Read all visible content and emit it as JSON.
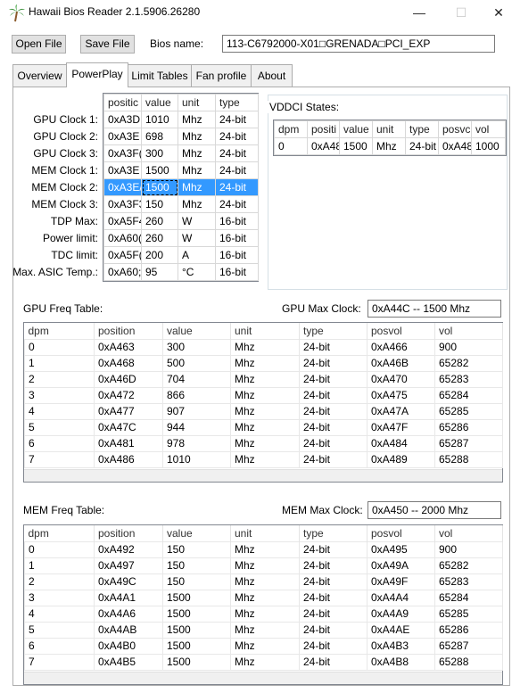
{
  "window": {
    "title": "Hawaii Bios Reader 2.1.5906.26280",
    "minimize": "—",
    "maximize": "☐",
    "close": "✕"
  },
  "toolbar": {
    "open_label": "Open File",
    "save_label": "Save File",
    "bios_name_label": "Bios name:",
    "bios_name_value": "113-C6792000-X01□GRENADA□PCI_EXP"
  },
  "tabs": [
    "Overview",
    "PowerPlay",
    "Limit Tables",
    "Fan profile",
    "About"
  ],
  "active_tab": "PowerPlay",
  "clocks": {
    "labels": [
      "GPU Clock 1:",
      "GPU Clock 2:",
      "GPU Clock 3:",
      "MEM Clock 1:",
      "MEM Clock 2:",
      "MEM Clock 3:",
      "TDP Max:",
      "Power limit:",
      "TDC limit:",
      "Max. ASIC Temp.:"
    ],
    "headers": [
      "positic",
      "value",
      "unit",
      "type"
    ],
    "rows": [
      [
        "0xA3D",
        "1010",
        "Mhz",
        "24-bit"
      ],
      [
        "0xA3E",
        "698",
        "Mhz",
        "24-bit"
      ],
      [
        "0xA3F(",
        "300",
        "Mhz",
        "24-bit"
      ],
      [
        "0xA3E",
        "1500",
        "Mhz",
        "24-bit"
      ],
      [
        "0xA3E/",
        "1500",
        "Mhz",
        "24-bit"
      ],
      [
        "0xA3F3",
        "150",
        "Mhz",
        "24-bit"
      ],
      [
        "0xA5F4",
        "260",
        "W",
        "16-bit"
      ],
      [
        "0xA60(",
        "260",
        "W",
        "16-bit"
      ],
      [
        "0xA5F(",
        "200",
        "A",
        "16-bit"
      ],
      [
        "0xA60;",
        "95",
        "°C",
        "16-bit"
      ]
    ],
    "selected_row": 4
  },
  "vddci": {
    "title": "VDDCI States:",
    "headers": [
      "dpm",
      "positi",
      "value",
      "unit",
      "type",
      "posvc",
      "vol"
    ],
    "rows": [
      [
        "0",
        "0xA48",
        "1500",
        "Mhz",
        "24-bit",
        "0xA48",
        "1000"
      ]
    ]
  },
  "gpu_freq": {
    "label": "GPU Freq Table:",
    "max_clock_label": "GPU Max Clock:",
    "max_clock_value": "0xA44C -- 1500 Mhz",
    "headers": [
      "dpm",
      "position",
      "value",
      "unit",
      "type",
      "posvol",
      "vol"
    ],
    "rows": [
      [
        "0",
        "0xA463",
        "300",
        "Mhz",
        "24-bit",
        "0xA466",
        "900"
      ],
      [
        "1",
        "0xA468",
        "500",
        "Mhz",
        "24-bit",
        "0xA46B",
        "65282"
      ],
      [
        "2",
        "0xA46D",
        "704",
        "Mhz",
        "24-bit",
        "0xA470",
        "65283"
      ],
      [
        "3",
        "0xA472",
        "866",
        "Mhz",
        "24-bit",
        "0xA475",
        "65284"
      ],
      [
        "4",
        "0xA477",
        "907",
        "Mhz",
        "24-bit",
        "0xA47A",
        "65285"
      ],
      [
        "5",
        "0xA47C",
        "944",
        "Mhz",
        "24-bit",
        "0xA47F",
        "65286"
      ],
      [
        "6",
        "0xA481",
        "978",
        "Mhz",
        "24-bit",
        "0xA484",
        "65287"
      ],
      [
        "7",
        "0xA486",
        "1010",
        "Mhz",
        "24-bit",
        "0xA489",
        "65288"
      ]
    ]
  },
  "mem_freq": {
    "label": "MEM Freq Table:",
    "max_clock_label": "MEM Max Clock:",
    "max_clock_value": "0xA450 -- 2000 Mhz",
    "headers": [
      "dpm",
      "position",
      "value",
      "unit",
      "type",
      "posvol",
      "vol"
    ],
    "rows": [
      [
        "0",
        "0xA492",
        "150",
        "Mhz",
        "24-bit",
        "0xA495",
        "900"
      ],
      [
        "1",
        "0xA497",
        "150",
        "Mhz",
        "24-bit",
        "0xA49A",
        "65282"
      ],
      [
        "2",
        "0xA49C",
        "150",
        "Mhz",
        "24-bit",
        "0xA49F",
        "65283"
      ],
      [
        "3",
        "0xA4A1",
        "1500",
        "Mhz",
        "24-bit",
        "0xA4A4",
        "65284"
      ],
      [
        "4",
        "0xA4A6",
        "1500",
        "Mhz",
        "24-bit",
        "0xA4A9",
        "65285"
      ],
      [
        "5",
        "0xA4AB",
        "1500",
        "Mhz",
        "24-bit",
        "0xA4AE",
        "65286"
      ],
      [
        "6",
        "0xA4B0",
        "1500",
        "Mhz",
        "24-bit",
        "0xA4B3",
        "65287"
      ],
      [
        "7",
        "0xA4B5",
        "1500",
        "Mhz",
        "24-bit",
        "0xA4B8",
        "65288"
      ]
    ]
  },
  "colors": {
    "selection": "#3399ff",
    "button_face": "#e1e1e1",
    "tab_inactive": "#f0f0f0",
    "icon_trunk": "#8b5a2b",
    "icon_leaves": "#2e8b2e"
  }
}
